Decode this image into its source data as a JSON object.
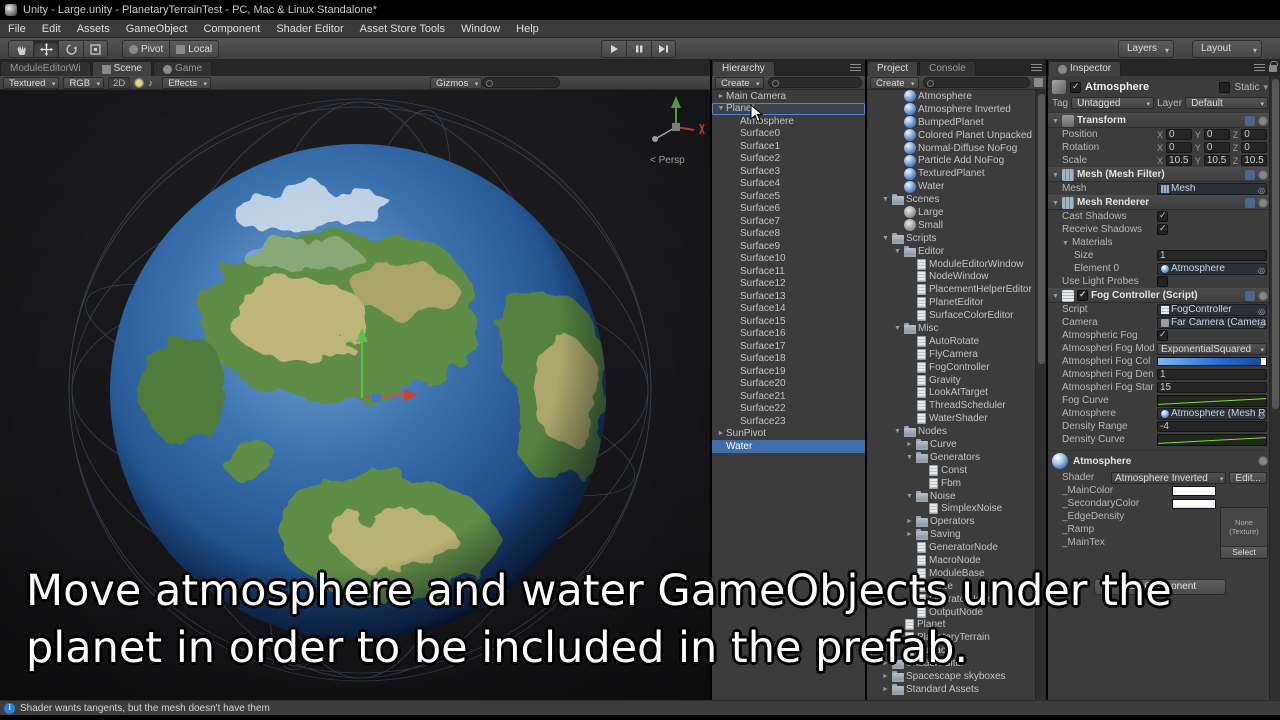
{
  "titlebar": {
    "title": "Unity - Large.unity - PlanetaryTerrainTest - PC, Mac & Linux Standalone*"
  },
  "menubar": {
    "items": [
      "File",
      "Edit",
      "Assets",
      "GameObject",
      "Component",
      "Shader Editor",
      "Asset Store Tools",
      "Window",
      "Help"
    ]
  },
  "toolbar": {
    "pivot": "Pivot",
    "local": "Local",
    "layers": "Layers",
    "layout": "Layout"
  },
  "scene": {
    "tabs": {
      "module": "ModuleEditorWi",
      "scene": "Scene",
      "game": "Game"
    },
    "controls": {
      "draw_mode": "Textured",
      "channels": "RGB",
      "mode_2d": "2D",
      "effects": "Effects",
      "gizmos": "Gizmos"
    },
    "persp_label": "< Persp"
  },
  "hierarchy": {
    "tab": "Hierarchy",
    "create": "Create",
    "items": [
      {
        "label": "Main Camera",
        "depth": 0,
        "arrow": "closed"
      },
      {
        "label": "Planet",
        "depth": 0,
        "arrow": "open",
        "cls": "drop"
      },
      {
        "label": "Atmosphere",
        "depth": 1
      },
      {
        "label": "Surface0",
        "depth": 1
      },
      {
        "label": "Surface1",
        "depth": 1
      },
      {
        "label": "Surface2",
        "depth": 1
      },
      {
        "label": "Surface3",
        "depth": 1
      },
      {
        "label": "Surface4",
        "depth": 1
      },
      {
        "label": "Surface5",
        "depth": 1
      },
      {
        "label": "Surface6",
        "depth": 1
      },
      {
        "label": "Surface7",
        "depth": 1
      },
      {
        "label": "Surface8",
        "depth": 1
      },
      {
        "label": "Surface9",
        "depth": 1
      },
      {
        "label": "Surface10",
        "depth": 1
      },
      {
        "label": "Surface11",
        "depth": 1
      },
      {
        "label": "Surface12",
        "depth": 1
      },
      {
        "label": "Surface13",
        "depth": 1
      },
      {
        "label": "Surface14",
        "depth": 1
      },
      {
        "label": "Surface15",
        "depth": 1
      },
      {
        "label": "Surface16",
        "depth": 1
      },
      {
        "label": "Surface17",
        "depth": 1
      },
      {
        "label": "Surface18",
        "depth": 1
      },
      {
        "label": "Surface19",
        "depth": 1
      },
      {
        "label": "Surface20",
        "depth": 1
      },
      {
        "label": "Surface21",
        "depth": 1
      },
      {
        "label": "Surface22",
        "depth": 1
      },
      {
        "label": "Surface23",
        "depth": 1
      },
      {
        "label": "SunPivot",
        "depth": 0,
        "arrow": "closed"
      },
      {
        "label": "Water",
        "depth": 0,
        "cls": "selected"
      }
    ]
  },
  "project": {
    "tabs": {
      "project": "Project",
      "console": "Console"
    },
    "create": "Create",
    "items": [
      {
        "label": "Atmosphere",
        "depth": 2,
        "kind": "material"
      },
      {
        "label": "Atmosphere Inverted",
        "depth": 2,
        "kind": "material"
      },
      {
        "label": "BumpedPlanet",
        "depth": 2,
        "kind": "material"
      },
      {
        "label": "Colored Planet Unpacked",
        "depth": 2,
        "kind": "material"
      },
      {
        "label": "Normal-Diffuse NoFog",
        "depth": 2,
        "kind": "material"
      },
      {
        "label": "Particle Add NoFog",
        "depth": 2,
        "kind": "material"
      },
      {
        "label": "TexturedPlanet",
        "depth": 2,
        "kind": "material"
      },
      {
        "label": "Water",
        "depth": 2,
        "kind": "material"
      },
      {
        "label": "Scenes",
        "depth": 1,
        "kind": "folder",
        "arrow": "open"
      },
      {
        "label": "Large",
        "depth": 2,
        "kind": "scene"
      },
      {
        "label": "Small",
        "depth": 2,
        "kind": "scene"
      },
      {
        "label": "Scripts",
        "depth": 1,
        "kind": "folder",
        "arrow": "open"
      },
      {
        "label": "Editor",
        "depth": 2,
        "kind": "folder",
        "arrow": "open"
      },
      {
        "label": "ModuleEditorWindow",
        "depth": 3,
        "kind": "script"
      },
      {
        "label": "NodeWindow",
        "depth": 3,
        "kind": "script"
      },
      {
        "label": "PlacementHelperEditor",
        "depth": 3,
        "kind": "script"
      },
      {
        "label": "PlanetEditor",
        "depth": 3,
        "kind": "script"
      },
      {
        "label": "SurfaceColorEditor",
        "depth": 3,
        "kind": "script"
      },
      {
        "label": "Misc",
        "depth": 2,
        "kind": "folder",
        "arrow": "open"
      },
      {
        "label": "AutoRotate",
        "depth": 3,
        "kind": "script"
      },
      {
        "label": "FlyCamera",
        "depth": 3,
        "kind": "script"
      },
      {
        "label": "FogController",
        "depth": 3,
        "kind": "script"
      },
      {
        "label": "Gravity",
        "depth": 3,
        "kind": "script"
      },
      {
        "label": "LookAtTarget",
        "depth": 3,
        "kind": "script"
      },
      {
        "label": "ThreadScheduler",
        "depth": 3,
        "kind": "script"
      },
      {
        "label": "WaterShader",
        "depth": 3,
        "kind": "script"
      },
      {
        "label": "Nodes",
        "depth": 2,
        "kind": "folder",
        "arrow": "open"
      },
      {
        "label": "Curve",
        "depth": 3,
        "kind": "folder",
        "arrow": "closed"
      },
      {
        "label": "Generators",
        "depth": 3,
        "kind": "folder",
        "arrow": "open"
      },
      {
        "label": "Const",
        "depth": 4,
        "kind": "script"
      },
      {
        "label": "Fbm",
        "depth": 4,
        "kind": "script"
      },
      {
        "label": "Noise",
        "depth": 3,
        "kind": "folder",
        "arrow": "open"
      },
      {
        "label": "SimplexNoise",
        "depth": 4,
        "kind": "script"
      },
      {
        "label": "Operators",
        "depth": 3,
        "kind": "folder",
        "arrow": "closed"
      },
      {
        "label": "Saving",
        "depth": 3,
        "kind": "folder",
        "arrow": "closed"
      },
      {
        "label": "GeneratorNode",
        "depth": 3,
        "kind": "script"
      },
      {
        "label": "MacroNode",
        "depth": 3,
        "kind": "script"
      },
      {
        "label": "ModuleBase",
        "depth": 3,
        "kind": "script"
      },
      {
        "label": "Node",
        "depth": 3,
        "kind": "script"
      },
      {
        "label": "OperatorNode",
        "depth": 3,
        "kind": "script"
      },
      {
        "label": "OutputNode",
        "depth": 3,
        "kind": "script"
      },
      {
        "label": "Planet",
        "depth": 2,
        "kind": "script"
      },
      {
        "label": "PlanetaryTerrain",
        "depth": 2,
        "kind": "script"
      },
      {
        "label": "Surface",
        "depth": 2,
        "kind": "script"
      },
      {
        "label": "ShaderEditor",
        "depth": 1,
        "kind": "folder",
        "arrow": "closed"
      },
      {
        "label": "Spacescape skyboxes",
        "depth": 1,
        "kind": "folder",
        "arrow": "closed"
      },
      {
        "label": "Standard Assets",
        "depth": 1,
        "kind": "folder",
        "arrow": "closed"
      }
    ]
  },
  "inspector": {
    "tab": "Inspector",
    "header": {
      "name": "Atmosphere",
      "static_label": "Static"
    },
    "tags": {
      "tag_label": "Tag",
      "tag_value": "Untagged",
      "layer_label": "Layer",
      "layer_value": "Default"
    },
    "transform": {
      "title": "Transform",
      "rows": [
        {
          "label": "Position",
          "xl": "X",
          "x": "0",
          "yl": "Y",
          "y": "0",
          "zl": "Z",
          "z": "0"
        },
        {
          "label": "Rotation",
          "xl": "X",
          "x": "0",
          "yl": "Y",
          "y": "0",
          "zl": "Z",
          "z": "0"
        },
        {
          "label": "Scale",
          "xl": "X",
          "x": "10.5",
          "yl": "Y",
          "y": "10.5",
          "zl": "Z",
          "z": "10.5"
        }
      ]
    },
    "mesh_filter": {
      "title": "Mesh (Mesh Filter)",
      "mesh_label": "Mesh",
      "mesh_value": "Mesh"
    },
    "mesh_renderer": {
      "title": "Mesh Renderer",
      "cast_label": "Cast Shadows",
      "receive_label": "Receive Shadows",
      "materials_label": "Materials",
      "size_label": "Size",
      "size_value": "1",
      "element_label": "Element 0",
      "element_value": "Atmosphere",
      "probes_label": "Use Light Probes"
    },
    "fog": {
      "title": "Fog Controller (Script)",
      "script_label": "Script",
      "script_value": "FogController",
      "camera_label": "Camera",
      "camera_value": "Far Camera (Camera)",
      "atmo_label": "Atmospheric Fog",
      "mod_label": "Atmospheri Fog Mod",
      "mod_value": "ExponentialSquared",
      "col_label": "Atmospheri Fog Col",
      "den_label": "Atmospheri Fog Den",
      "den_value": "1",
      "star_label": "Atmospheri Fog Star",
      "star_value": "15",
      "curve_label": "Fog Curve",
      "atmos_label": "Atmosphere",
      "atmos_value": "Atmosphere (Mesh Re",
      "range_label": "Density Range",
      "range_value": "-4",
      "dcurve_label": "Density Curve"
    },
    "material": {
      "name": "Atmosphere",
      "shader_label": "Shader",
      "shader_value": "Atmosphere Inverted",
      "edit_label": "Edit...",
      "props": [
        "_MainColor",
        "_SecondaryColor",
        "_EdgeDensity",
        "_Ramp",
        "_MainTex"
      ],
      "tex_none_1": "None",
      "tex_none_2": "(Texture)",
      "select_label": "Select"
    },
    "add_component": "Add Component"
  },
  "caption": {
    "line1": "Move atmosphere and water GameObjects under the",
    "line2": "planet in order to be included in the prefab."
  },
  "statusbar": {
    "message": "Shader wants tangents, but the mesh  doesn't have them"
  }
}
